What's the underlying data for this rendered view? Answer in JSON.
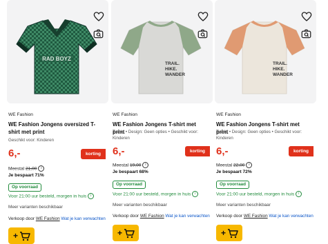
{
  "products": [
    {
      "brand": "WE Fashion",
      "title": "WE Fashion Jongens oversized T-shirt met print",
      "meta": "Geschikt voor: Kinderen",
      "price": "6,-",
      "discount_label": "korting",
      "old_price_label": "Meestal",
      "old_price": "21,00",
      "savings": "Je bespaart 71%",
      "stock": "Op voorraad",
      "delivery": "Voor 21:00 uur besteld, morgen in huis",
      "variants": "Meer varianten beschikbaar",
      "seller_prefix": "Verkoop door",
      "seller": "WE Fashion",
      "seller_info": "Wat je kan verwachten",
      "shirt_body_color": "#1f5a40",
      "shirt_sleeve_color": "#1a4d37",
      "shirt_print": "RAD BOYZ"
    },
    {
      "brand": "WE Fashion",
      "title": "WE Fashion Jongens T-shirt met print",
      "meta": "T-shirt • Design: Geen opties • Geschikt voor: Kinderen",
      "price": "6,-",
      "discount_label": "korting",
      "old_price_label": "Meestal",
      "old_price": "19,00",
      "savings": "Je bespaart 68%",
      "stock": "Op voorraad",
      "delivery": "Voor 21:00 uur besteld, morgen in huis",
      "variants": "Meer varianten beschikbaar",
      "seller_prefix": "Verkoop door",
      "seller": "WE Fashion",
      "seller_info": "Wat je kan verwachten",
      "shirt_body_color": "#d9d9d6",
      "shirt_sleeve_color": "#8fa889",
      "shirt_print": "TRAIL HIKE WANDER"
    },
    {
      "brand": "WE Fashion",
      "title": "WE Fashion Jongens T-shirt met print",
      "meta": "T-shirt • Design: Geen opties • Geschikt voor: Kinderen",
      "price": "6,-",
      "discount_label": "korting",
      "old_price_label": "Meestal",
      "old_price": "22,00",
      "savings": "Je bespaart 72%",
      "stock": "Op voorraad",
      "delivery": "Voor 21:00 uur besteld, morgen in huis",
      "variants": "Meer varianten beschikbaar",
      "seller_prefix": "Verkoop door",
      "seller": "WE Fashion",
      "seller_info": "Wat je kan verwachten",
      "shirt_body_color": "#ece6dc",
      "shirt_sleeve_color": "#e09a72",
      "shirt_print": "TRAIL HIKE WANDER"
    }
  ],
  "icons": {
    "wishlist": "heart-icon",
    "image_search": "camera-search-icon",
    "info": "info-icon",
    "cart": "cart-icon"
  },
  "colors": {
    "price_red": "#e0311b",
    "stock_green": "#1f8a3a",
    "cart_yellow": "#f7b800",
    "link_blue": "#0a55c8"
  },
  "cart_label": "+"
}
